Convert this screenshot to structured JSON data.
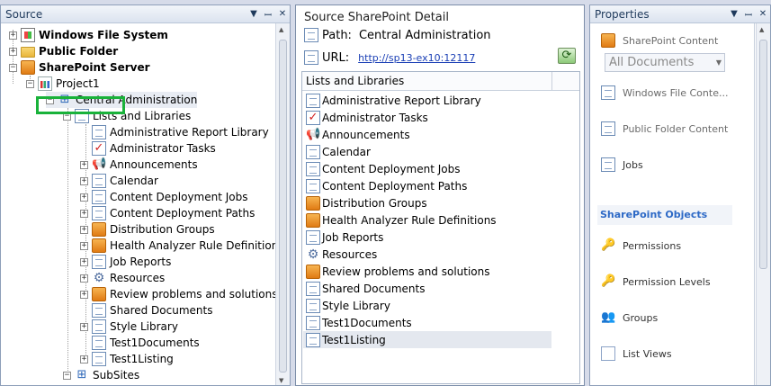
{
  "left_panel": {
    "title": "Source",
    "tree": [
      {
        "label": "Windows File System",
        "bold": true
      },
      {
        "label": "Public Folder",
        "bold": true
      },
      {
        "label": "SharePoint Server",
        "bold": true
      },
      {
        "label": "Project1"
      },
      {
        "label": "Central Administration"
      },
      {
        "label": "Lists and Libraries"
      },
      {
        "label": "Administrative Report Library"
      },
      {
        "label": "Administrator Tasks"
      },
      {
        "label": "Announcements"
      },
      {
        "label": "Calendar"
      },
      {
        "label": "Content Deployment Jobs"
      },
      {
        "label": "Content Deployment Paths"
      },
      {
        "label": "Distribution Groups"
      },
      {
        "label": "Health Analyzer Rule Definitions"
      },
      {
        "label": "Job Reports"
      },
      {
        "label": "Resources"
      },
      {
        "label": "Review problems and solutions"
      },
      {
        "label": "Shared Documents"
      },
      {
        "label": "Style Library"
      },
      {
        "label": "Test1Documents"
      },
      {
        "label": "Test1Listing"
      },
      {
        "label": "SubSites"
      }
    ]
  },
  "middle_panel": {
    "title": "Source SharePoint Detail",
    "path_label": "Path:",
    "path_value": "Central Administration",
    "url_label": "URL:",
    "url_value": "http://sp13-ex10:12117",
    "list_header": "Lists and Libraries",
    "items": [
      "Administrative Report Library",
      "Administrator Tasks",
      "Announcements",
      "Calendar",
      "Content Deployment Jobs",
      "Content Deployment Paths",
      "Distribution Groups",
      "Health Analyzer Rule Definitions",
      "Job Reports",
      "Resources",
      "Review problems and solutions",
      "Shared Documents",
      "Style Library",
      "Test1Documents",
      "Test1Listing"
    ]
  },
  "right_panel": {
    "title": "Properties",
    "sharepoint_content": "SharePoint Content",
    "dropdown_value": "All Documents",
    "windows_file_content": "Windows File Conte...",
    "public_folder_content": "Public Folder Content",
    "jobs": "Jobs",
    "section_title": "SharePoint Objects",
    "permissions": "Permissions",
    "permission_levels": "Permission Levels",
    "groups": "Groups",
    "list_views": "List Views"
  }
}
